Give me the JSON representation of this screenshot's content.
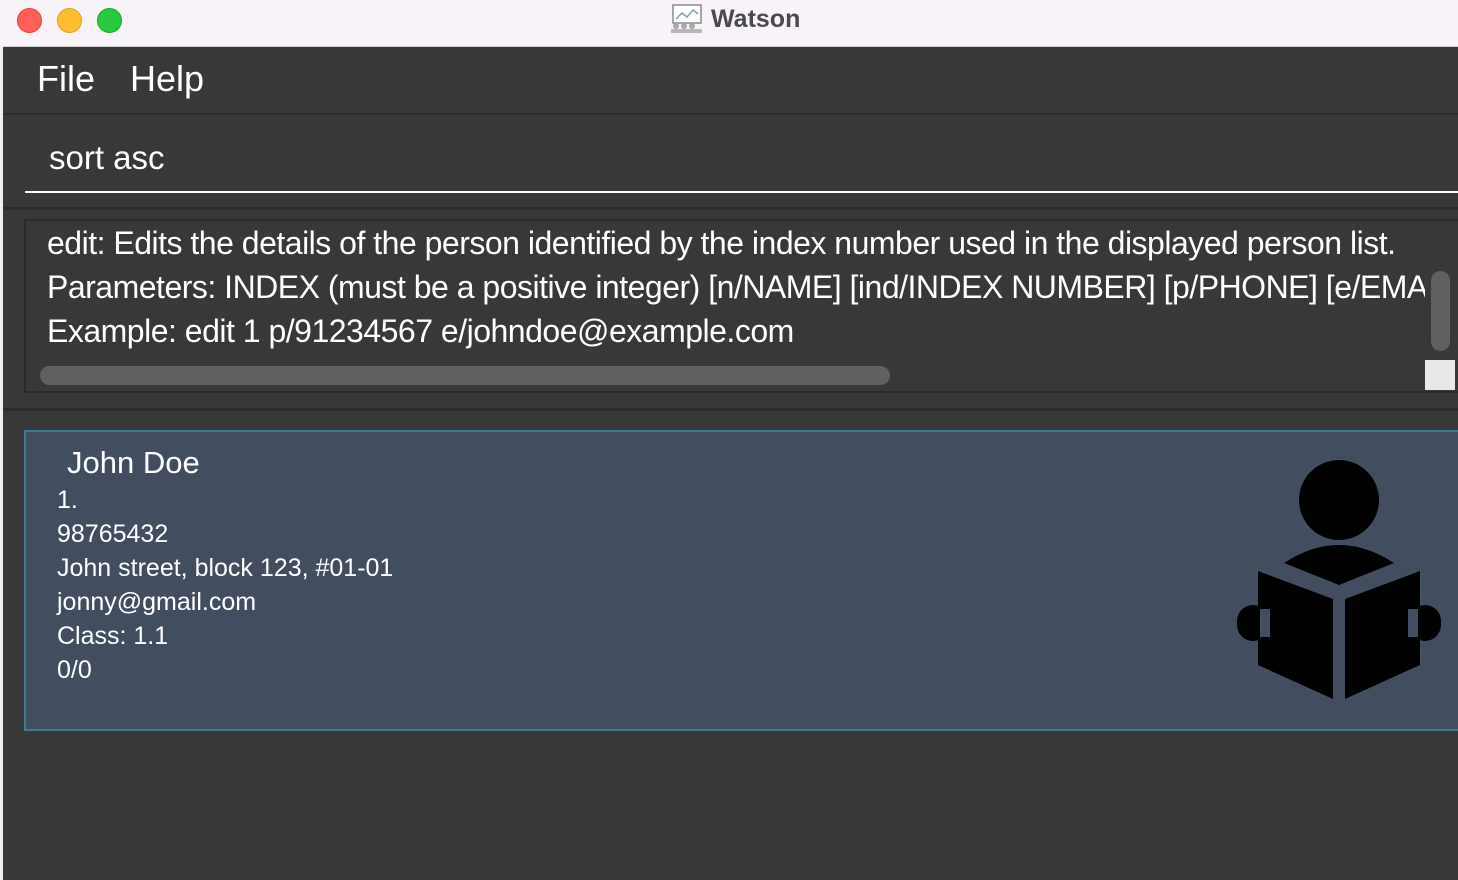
{
  "window": {
    "title": "Watson"
  },
  "menu": {
    "file_label": "File",
    "help_label": "Help"
  },
  "command": {
    "value": "sort asc"
  },
  "result": {
    "lines": [
      "edit: Edits the details of the person identified by the index number used in the displayed person list.",
      "Parameters: INDEX (must be a positive integer) [n/NAME] [ind/INDEX NUMBER] [p/PHONE] [e/EMAIL]",
      "Example: edit 1 p/91234567 e/johndoe@example.com"
    ]
  },
  "person_list": [
    {
      "name": "John Doe",
      "index": "1.",
      "phone": "98765432",
      "address": "John street, block 123, #01-01",
      "email": "jonny@gmail.com",
      "class": "Class: 1.1",
      "attendance": "0/0",
      "icon": "student-reading-icon"
    }
  ],
  "colors": {
    "titlebar_bg": "#f7f3f8",
    "app_bg": "#383838",
    "card_bg": "#424e60",
    "card_border": "#3e7b91",
    "close": "#ff5f57",
    "minimize": "#febc2e",
    "maximize": "#28c840"
  }
}
